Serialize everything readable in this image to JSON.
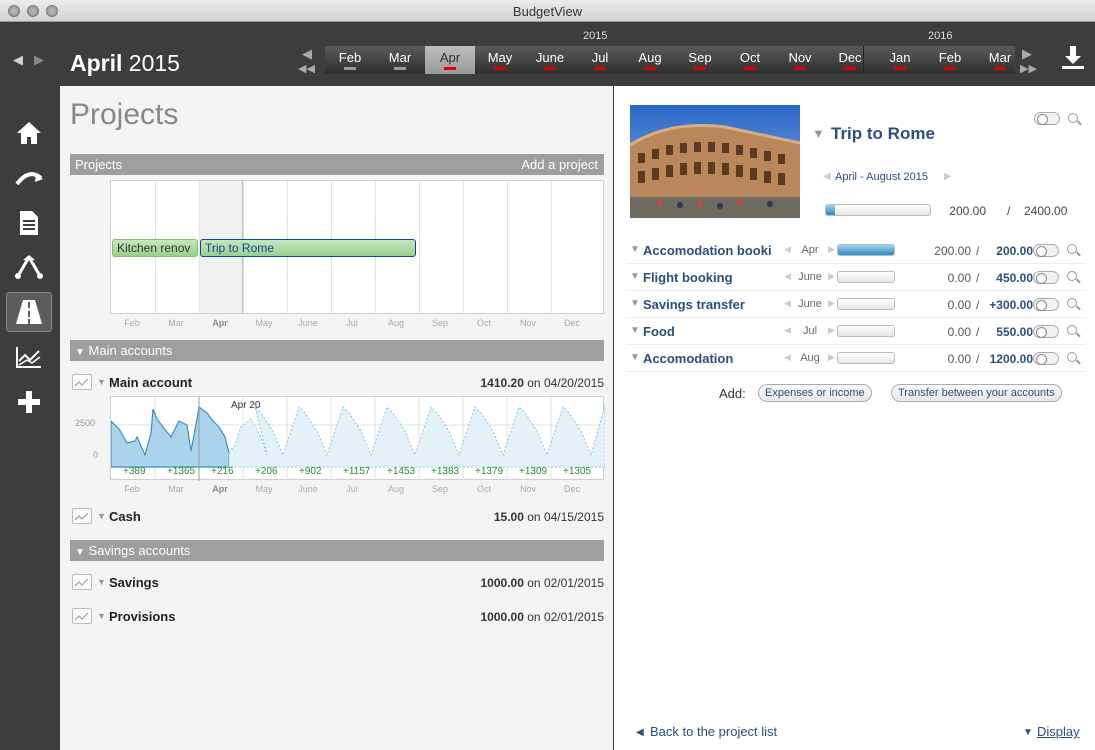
{
  "window": {
    "title": "BudgetView"
  },
  "header": {
    "month": "April",
    "year": "2015",
    "timeline": {
      "years": [
        "2015",
        "2016"
      ],
      "months": [
        "Feb",
        "Mar",
        "Apr",
        "May",
        "June",
        "Jul",
        "Aug",
        "Sep",
        "Oct",
        "Nov",
        "Dec",
        "Jan",
        "Feb",
        "Mar"
      ],
      "selected_index": 2
    }
  },
  "sidebar": {
    "items": [
      {
        "name": "home-icon",
        "glyph": "⌂"
      },
      {
        "name": "categorize-icon",
        "glyph": "↷"
      },
      {
        "name": "document-icon",
        "glyph": "▤"
      },
      {
        "name": "budget-icon",
        "glyph": "⇵"
      },
      {
        "name": "projects-icon",
        "glyph": "▲"
      },
      {
        "name": "analysis-icon",
        "glyph": "≈"
      },
      {
        "name": "add-icon",
        "glyph": "+"
      }
    ]
  },
  "projects_page": {
    "title": "Projects",
    "section_label": "Projects",
    "add_label": "Add a project",
    "gantt": {
      "bars": [
        {
          "label": "Kitchen renov",
          "start_month": 0,
          "span": 2
        },
        {
          "label": "Trip to Rome",
          "start_month": 2,
          "span": 5
        }
      ],
      "months": [
        "Feb",
        "Mar",
        "Apr",
        "May",
        "June",
        "Jul",
        "Aug",
        "Sep",
        "Oct",
        "Nov",
        "Dec"
      ]
    },
    "main_accounts": {
      "label": "Main accounts",
      "accounts": [
        {
          "name": "Main account",
          "value": "1410.20",
          "date_prefix": "on",
          "date": "04/20/2015"
        },
        {
          "name": "Cash",
          "value": "15.00",
          "date_prefix": "on",
          "date": "04/15/2015"
        }
      ],
      "chart": {
        "date_label": "Apr 20",
        "y_ticks": [
          "2500",
          "0"
        ],
        "increments": [
          "+389",
          "+1365",
          "+216",
          "+206",
          "+902",
          "+1157",
          "+1453",
          "+1383",
          "+1379",
          "+1309",
          "+1305"
        ],
        "months": [
          "Feb",
          "Mar",
          "Apr",
          "May",
          "June",
          "Jul",
          "Aug",
          "Sep",
          "Oct",
          "Nov",
          "Dec"
        ]
      }
    },
    "savings_accounts": {
      "label": "Savings accounts",
      "accounts": [
        {
          "name": "Savings",
          "value": "1000.00",
          "date_prefix": "on",
          "date": "02/01/2015"
        },
        {
          "name": "Provisions",
          "value": "1000.00",
          "date_prefix": "on",
          "date": "02/01/2015"
        }
      ]
    }
  },
  "project_detail": {
    "title": "Trip to Rome",
    "dates": "April - August 2015",
    "actual": "200.00",
    "slash": "/",
    "planned": "2400.00",
    "progress_fraction": 0.083,
    "items": [
      {
        "name": "Accomodation booki",
        "month": "Apr",
        "actual": "200.00",
        "planned": "200.00",
        "fill": 1.0
      },
      {
        "name": "Flight booking",
        "month": "June",
        "actual": "0.00",
        "planned": "450.00",
        "fill": 0
      },
      {
        "name": "Savings transfer",
        "month": "June",
        "actual": "0.00",
        "planned": "+300.00",
        "fill": 0
      },
      {
        "name": "Food",
        "month": "Jul",
        "actual": "0.00",
        "planned": "550.00",
        "fill": 0
      },
      {
        "name": "Accomodation",
        "month": "Aug",
        "actual": "0.00",
        "planned": "1200.00",
        "fill": 0
      }
    ],
    "add_label": "Add:",
    "add_expenses_label": "Expenses or income",
    "add_transfer_label": "Transfer between your accounts",
    "back_label": "Back to the project list",
    "display_label": "Display"
  },
  "colors": {
    "accent_blue": "#2a4f7a",
    "bar_green": "#a8d8a0",
    "increment_green": "#2e8b2e",
    "alert_red": "#e00000"
  }
}
